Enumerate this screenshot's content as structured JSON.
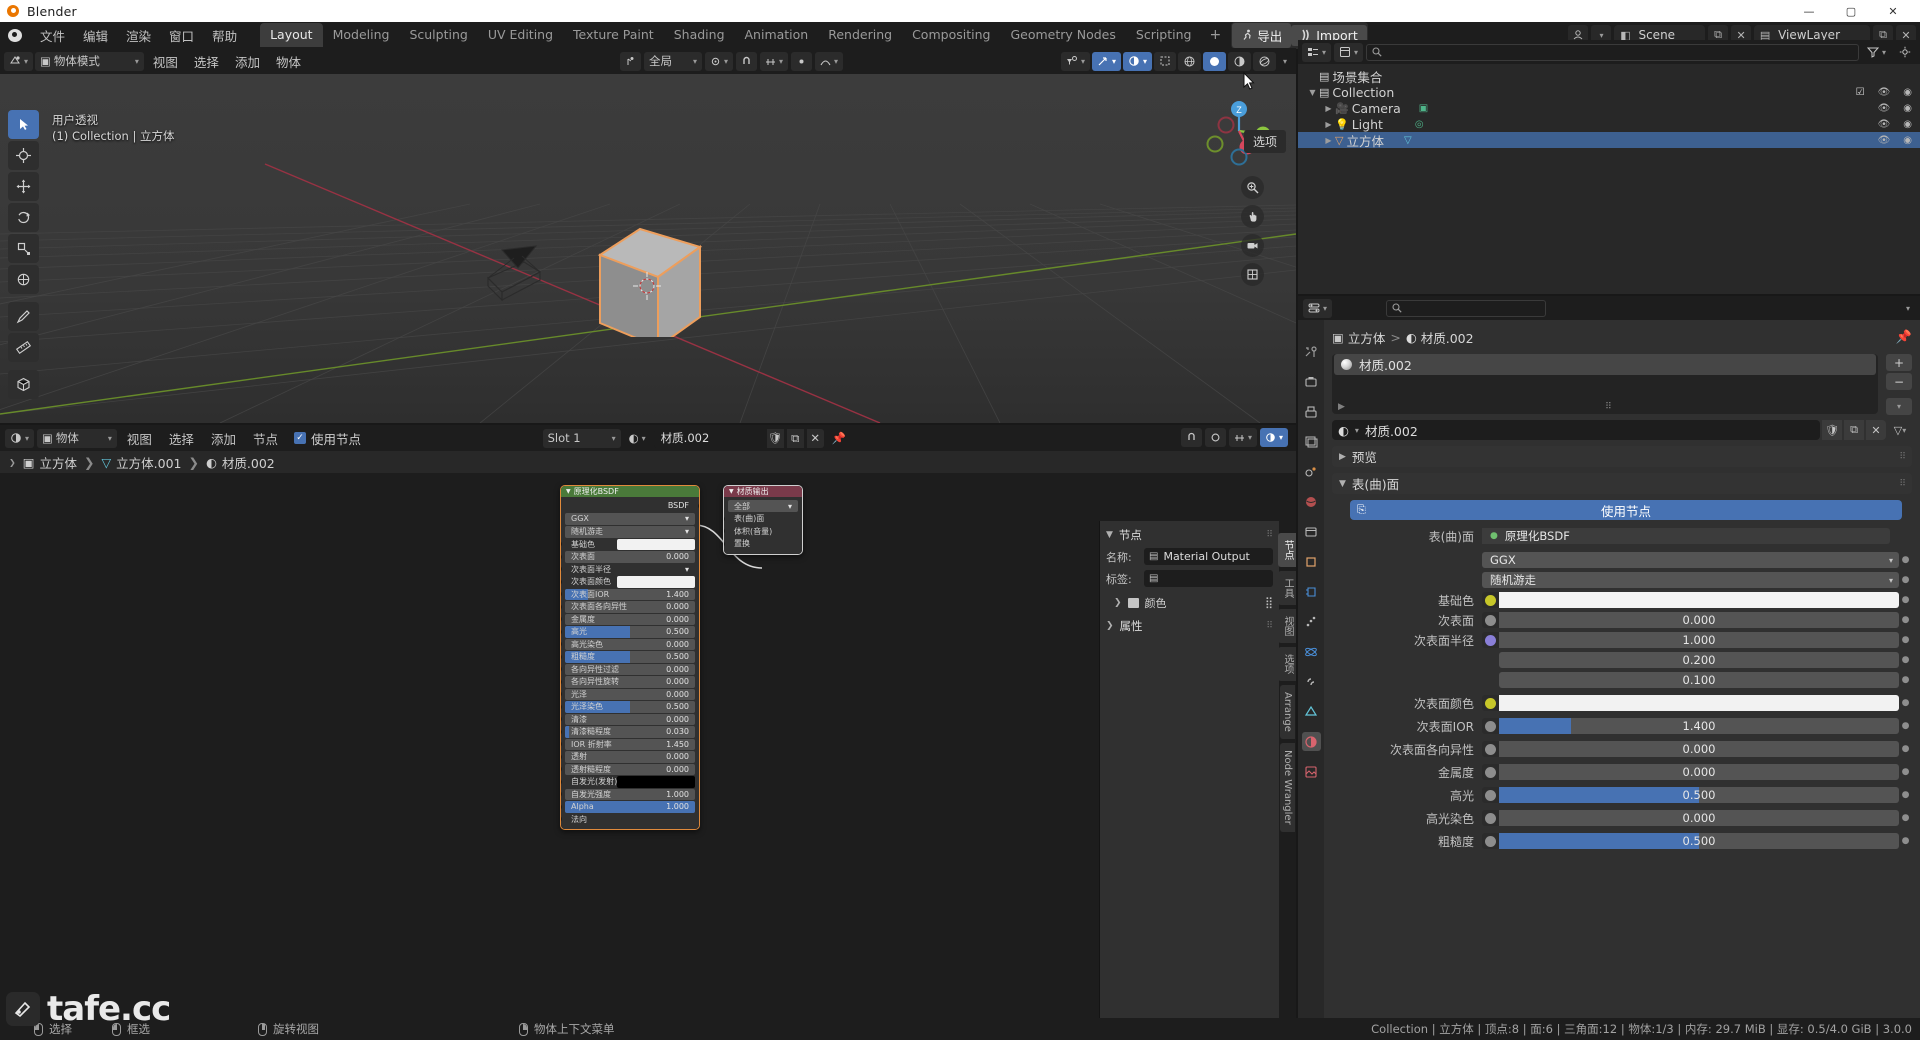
{
  "window": {
    "title": "Blender",
    "minimize": "—",
    "maximize": "▢",
    "close": "✕"
  },
  "topbar": {
    "menus": [
      "文件",
      "编辑",
      "渲染",
      "窗口",
      "帮助"
    ],
    "workspace_tabs": [
      {
        "label": "Layout",
        "active": true
      },
      {
        "label": "Modeling",
        "active": false
      },
      {
        "label": "Sculpting",
        "active": false
      },
      {
        "label": "UV Editing",
        "active": false
      },
      {
        "label": "Texture Paint",
        "active": false
      },
      {
        "label": "Shading",
        "active": false
      },
      {
        "label": "Animation",
        "active": false
      },
      {
        "label": "Rendering",
        "active": false
      },
      {
        "label": "Compositing",
        "active": false
      },
      {
        "label": "Geometry Nodes",
        "active": false
      },
      {
        "label": "Scripting",
        "active": false
      }
    ],
    "add_workspace": "+",
    "extra_tabs": [
      {
        "label": "导出",
        "active": true,
        "icon": "runner-icon"
      },
      {
        "label": "Import",
        "active": true,
        "icon": "import-icon"
      }
    ],
    "scene_name": "Scene",
    "viewlayer_name": "ViewLayer"
  },
  "viewport": {
    "header": {
      "mode": "物体模式",
      "menus": [
        "视图",
        "选择",
        "添加",
        "物体"
      ],
      "transform_orientation": "全局",
      "options_tooltip": "选项"
    },
    "overlay_text_line1": "用户透视",
    "overlay_text_line2": "(1) Collection | 立方体",
    "gizmo_axes": [
      "Z",
      "Y",
      "X"
    ],
    "tools": [
      "select-box-tool",
      "cursor-tool",
      "move-tool",
      "rotate-tool",
      "scale-tool",
      "transform-tool",
      "annotate-tool",
      "measure-tool",
      "add-cube-tool"
    ]
  },
  "outliner": {
    "search_placeholder": "",
    "rows": [
      {
        "name": "场景集合",
        "depth": 0,
        "icon": "collection-icon",
        "selected": false,
        "expander": "",
        "show_eye": false,
        "show_camera": false,
        "checkbox": false
      },
      {
        "name": "Collection",
        "depth": 1,
        "icon": "collection-icon",
        "selected": false,
        "expander": "▼",
        "show_eye": true,
        "show_camera": true,
        "checkbox": true
      },
      {
        "name": "Camera",
        "depth": 2,
        "icon": "camera-obj-icon",
        "selected": false,
        "expander": "▶",
        "show_eye": true,
        "show_camera": true,
        "checkbox": false
      },
      {
        "name": "Light",
        "depth": 2,
        "icon": "light-obj-icon",
        "selected": false,
        "expander": "▶",
        "show_eye": true,
        "show_camera": true,
        "checkbox": false
      },
      {
        "name": "立方体",
        "depth": 2,
        "icon": "mesh-obj-icon",
        "selected": true,
        "expander": "▶",
        "show_eye": true,
        "show_camera": true,
        "checkbox": false
      }
    ]
  },
  "properties": {
    "breadcrumb": [
      {
        "label": "立方体",
        "icon": "object-icon"
      },
      {
        "label": "材质.002",
        "icon": "material-icon"
      }
    ],
    "material_slot": "材质.002",
    "material_id_name": "材质.002",
    "panels": [
      {
        "label": "预览",
        "expanded": false
      },
      {
        "label": "表(曲)面",
        "expanded": true
      }
    ],
    "use_nodes_label": "使用节点",
    "surface_label": "表(曲)面",
    "surface_value": "原理化BSDF",
    "distribution": "GGX",
    "subsurface_method": "随机游走",
    "rows": [
      {
        "label": "基础色",
        "type": "color",
        "value": "",
        "socket": "yellow"
      },
      {
        "label": "次表面",
        "type": "value",
        "value": "0.000",
        "fill": 0,
        "socket": "grey"
      },
      {
        "label": "次表面半径",
        "type": "value",
        "value": "1.000",
        "fill": 0,
        "socket": "purple"
      },
      {
        "label": "",
        "type": "value",
        "value": "0.200",
        "fill": 0,
        "socket": "none"
      },
      {
        "label": "",
        "type": "value",
        "value": "0.100",
        "fill": 0,
        "socket": "none"
      },
      {
        "label": "次表面颜色",
        "type": "color",
        "value": "",
        "socket": "yellow"
      },
      {
        "label": "次表面IOR",
        "type": "value",
        "value": "1.400",
        "fill": 18,
        "socket": "grey"
      },
      {
        "label": "次表面各向异性",
        "type": "value",
        "value": "0.000",
        "fill": 0,
        "socket": "grey"
      },
      {
        "label": "金属度",
        "type": "value",
        "value": "0.000",
        "fill": 0,
        "socket": "grey"
      },
      {
        "label": "高光",
        "type": "value",
        "value": "0.500",
        "fill": 50,
        "socket": "grey"
      },
      {
        "label": "高光染色",
        "type": "value",
        "value": "0.000",
        "fill": 0,
        "socket": "grey"
      },
      {
        "label": "粗糙度",
        "type": "value",
        "value": "0.500",
        "fill": 50,
        "socket": "grey"
      }
    ]
  },
  "shader_editor": {
    "header": {
      "shader_type": "物体",
      "menus": [
        "视图",
        "选择",
        "添加",
        "节点"
      ],
      "use_nodes_label": "使用节点",
      "slot": "Slot 1",
      "material_name": "材质.002"
    },
    "breadcrumb": [
      {
        "label": "立方体",
        "icon": "object-icon"
      },
      {
        "label": "立方体.001",
        "icon": "mesh-data-icon"
      },
      {
        "label": "材质.002",
        "icon": "material-icon"
      }
    ],
    "nodes": [
      {
        "id": "principled",
        "title": "原理化BSDF",
        "header_color": "#4a7a3a",
        "outputs": [
          {
            "label": "BSDF",
            "color": "#5cc65c"
          }
        ],
        "dropdowns": [
          "GGX",
          "随机游走"
        ],
        "rows": [
          {
            "label": "基础色",
            "value": "",
            "style": "white",
            "socket": "yellow"
          },
          {
            "label": "次表面",
            "value": "0.000",
            "style": "grey",
            "socket": "grey"
          },
          {
            "label": "次表面半径",
            "value": "",
            "style": "none",
            "socket": "purple"
          },
          {
            "label": "次表面颜色",
            "value": "",
            "style": "white",
            "socket": "yellow"
          },
          {
            "label": "次表面IOR",
            "value": "1.400",
            "style": "part18",
            "socket": "grey"
          },
          {
            "label": "次表面各向异性",
            "value": "0.000",
            "style": "grey",
            "socket": "grey"
          },
          {
            "label": "金属度",
            "value": "0.000",
            "style": "grey",
            "socket": "grey"
          },
          {
            "label": "高光",
            "value": "0.500",
            "style": "half",
            "socket": "grey"
          },
          {
            "label": "高光染色",
            "value": "0.000",
            "style": "grey",
            "socket": "grey"
          },
          {
            "label": "粗糙度",
            "value": "0.500",
            "style": "half",
            "socket": "grey"
          },
          {
            "label": "各向异性过滤",
            "value": "0.000",
            "style": "grey",
            "socket": "grey"
          },
          {
            "label": "各向异性旋转",
            "value": "0.000",
            "style": "grey",
            "socket": "grey"
          },
          {
            "label": "光泽",
            "value": "0.000",
            "style": "grey",
            "socket": "grey"
          },
          {
            "label": "光泽染色",
            "value": "0.500",
            "style": "half",
            "socket": "grey"
          },
          {
            "label": "清漆",
            "value": "0.000",
            "style": "grey",
            "socket": "grey"
          },
          {
            "label": "清漆糙程度",
            "value": "0.030",
            "style": "grey",
            "socket": "grey"
          },
          {
            "label": "IOR 折射率",
            "value": "1.450",
            "style": "grey",
            "socket": "grey"
          },
          {
            "label": "透射",
            "value": "0.000",
            "style": "grey",
            "socket": "grey"
          },
          {
            "label": "透射糙程度",
            "value": "0.000",
            "style": "grey",
            "socket": "grey"
          },
          {
            "label": "自发光(发射)",
            "value": "",
            "style": "black",
            "socket": "yellow"
          },
          {
            "label": "自发光强度",
            "value": "1.000",
            "style": "grey",
            "socket": "grey"
          },
          {
            "label": "Alpha",
            "value": "1.000",
            "style": "blue",
            "socket": "grey"
          },
          {
            "label": "法向",
            "value": "",
            "style": "none",
            "socket": "purple"
          }
        ]
      },
      {
        "id": "output",
        "title": "材质输出",
        "header_color": "#7a3a4a",
        "dropdowns": [
          "全部"
        ],
        "inputs": [
          {
            "label": "表(曲)面",
            "color": "#5cc65c"
          },
          {
            "label": "体积(音量)",
            "color": "#5cc65c"
          },
          {
            "label": "置换",
            "color": "#8a7fd8"
          }
        ]
      }
    ],
    "side_panel": {
      "tabs": [
        "节点",
        "工具",
        "视图",
        "选项",
        "Arrange",
        "Node Wrangler"
      ],
      "active_tab": "节点",
      "panel_title": "节点",
      "name_label": "名称:",
      "name_value": "Material Output",
      "label_label": "标签:",
      "label_value": "",
      "color_row": "颜色",
      "attributes_panel": "属性"
    }
  },
  "statusbar": {
    "hints": [
      {
        "icon": "mouse-left",
        "label": "选择"
      },
      {
        "icon": "mouse-left-drag",
        "label": "框选"
      },
      {
        "icon": "mouse-middle",
        "label": "旋转视图"
      },
      {
        "icon": "mouse-right",
        "label": "物体上下文菜单"
      }
    ],
    "stats": "Collection | 立方体 | 顶点:8 | 面:6 | 三角面:12 | 物体:1/3 | 内存: 29.7 MiB | 显存: 0.5/4.0 GiB | 3.0.0"
  },
  "watermark": {
    "text": "tafe.cc"
  },
  "colors": {
    "accent": "#4772b3",
    "selected_object_outline": "#ed9e5c",
    "panel_bg": "#303030",
    "header_bg": "#1d1d1d",
    "outliner_bg": "#282828"
  }
}
